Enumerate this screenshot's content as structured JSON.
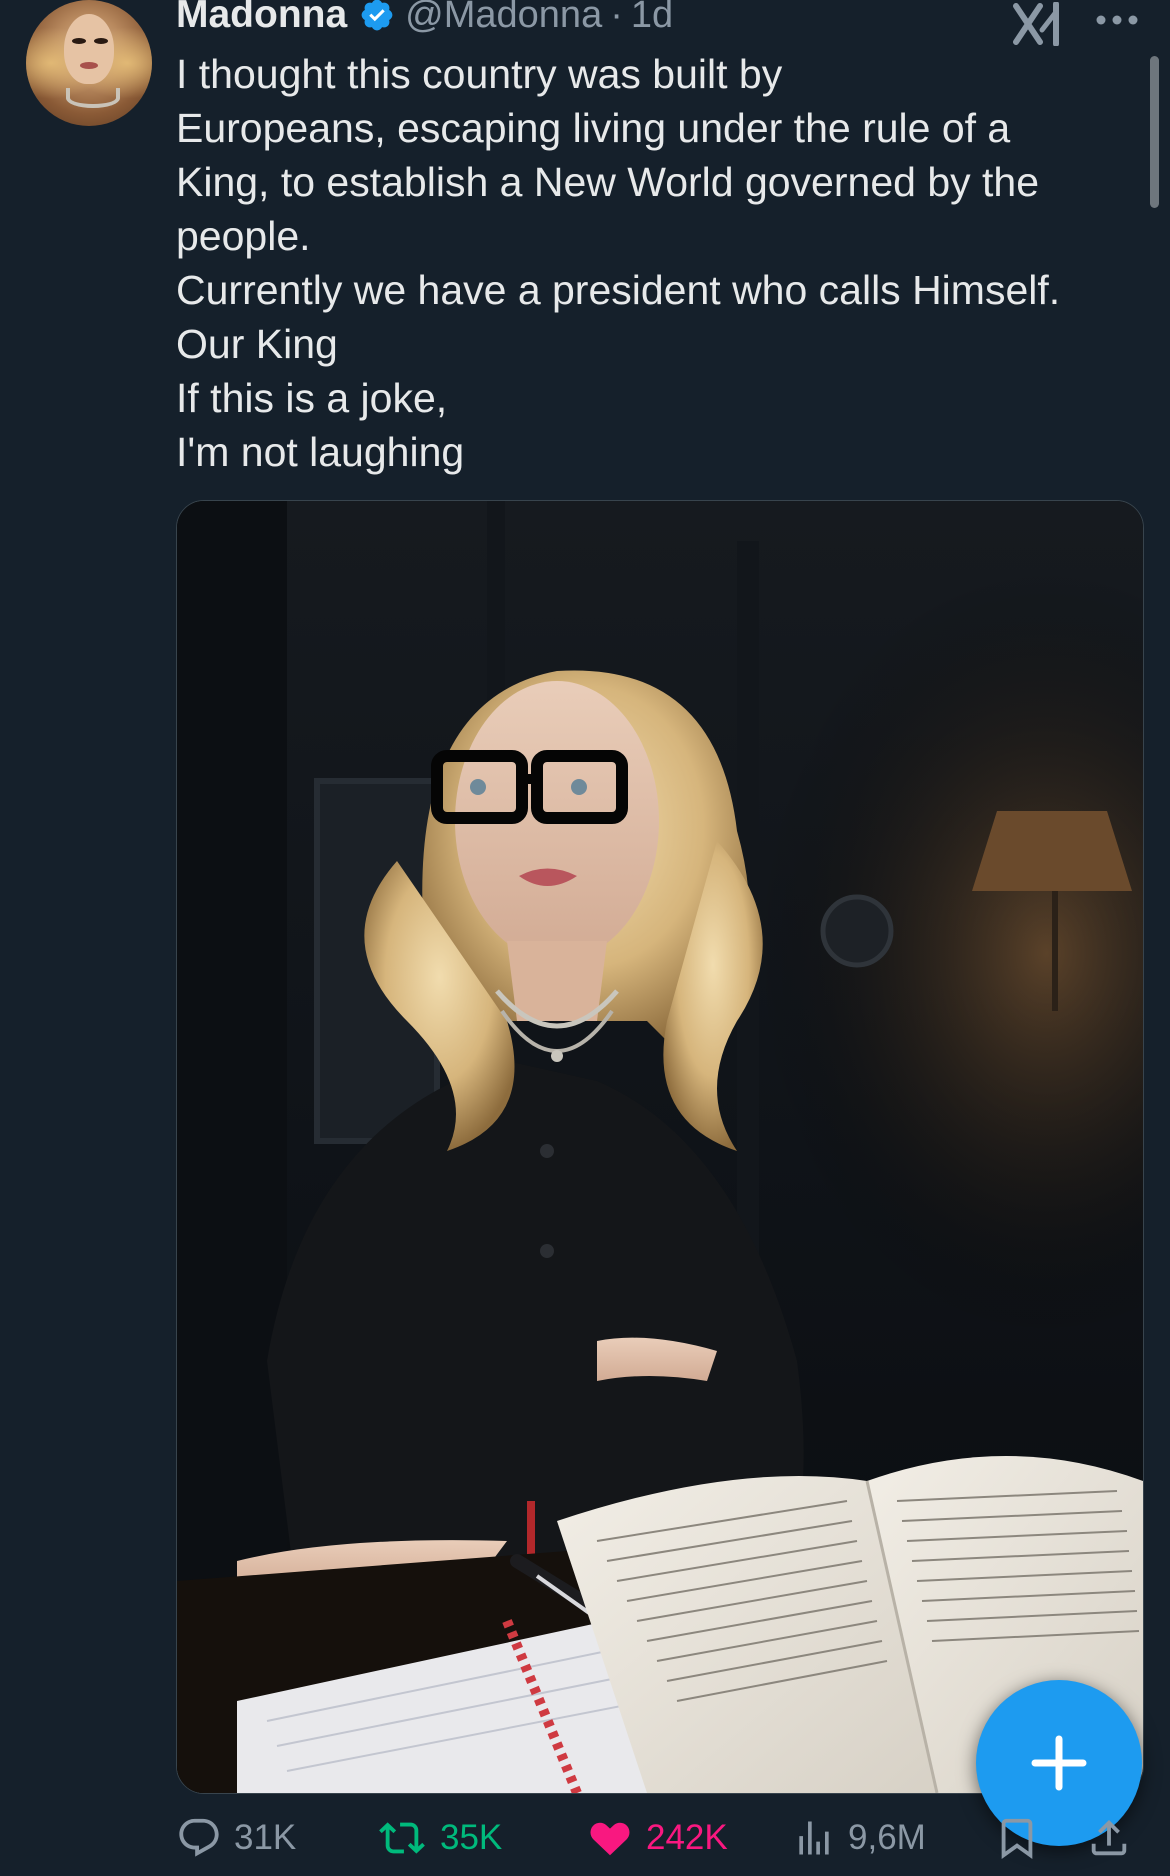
{
  "tweet": {
    "author_name": "Madonna",
    "handle": "@Madonna",
    "separator": "·",
    "timestamp": "1d",
    "text_lines": [
      "I thought this country was built by",
      "Europeans, escaping living under the rule of a",
      "King, to establish a New World governed by the",
      "people.",
      "Currently we have a president who calls Himself.",
      "Our King",
      "If this is a joke,",
      "I'm not laughing"
    ]
  },
  "icons": {
    "verified": "verified-badge-icon",
    "grok": "grok-icon",
    "more": "more-options-icon",
    "reply": "reply-icon",
    "retweet": "retweet-icon",
    "like": "heart-icon",
    "views": "views-icon",
    "bookmark": "bookmark-icon",
    "share": "share-icon",
    "compose": "plus-icon"
  },
  "actions": {
    "replies": "31K",
    "retweets": "35K",
    "likes": "242K",
    "views": "9,6M"
  },
  "colors": {
    "background": "#15202b",
    "text": "#e7e9ea",
    "secondary": "#8b98a5",
    "accent_blue": "#1d9bf0",
    "retweet_green": "#00ba7c",
    "like_pink": "#f91880"
  }
}
